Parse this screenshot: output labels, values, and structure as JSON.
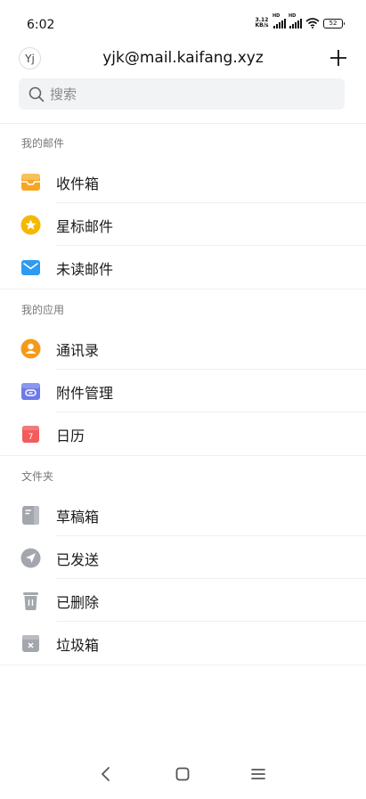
{
  "status_bar": {
    "time": "6:02",
    "net_speed_value": "3.12",
    "net_speed_unit": "KB/s",
    "hd1": "HD",
    "hd2": "HD",
    "battery": "52"
  },
  "header": {
    "avatar_initials": "Yj",
    "account_email": "yjk@mail.kaifang.xyz",
    "add_icon": "plus-icon"
  },
  "search": {
    "placeholder": "搜索",
    "value": ""
  },
  "sections": {
    "my_mail": {
      "title": "我的邮件",
      "items": [
        {
          "label": "收件箱",
          "icon": "inbox-icon",
          "color": "#f7a623"
        },
        {
          "label": "星标邮件",
          "icon": "star-icon",
          "color": "#f5b800"
        },
        {
          "label": "未读邮件",
          "icon": "envelope-icon",
          "color": "#2f9bf0"
        }
      ]
    },
    "my_apps": {
      "title": "我的应用",
      "items": [
        {
          "label": "通讯录",
          "icon": "contacts-icon",
          "color": "#f59a18"
        },
        {
          "label": "附件管理",
          "icon": "attachment-icon",
          "color": "#6e7ae8"
        },
        {
          "label": "日历",
          "icon": "calendar-icon",
          "color": "#f25c5c",
          "badge": "7"
        }
      ]
    },
    "folders": {
      "title": "文件夹",
      "items": [
        {
          "label": "草稿箱",
          "icon": "drafts-icon",
          "color": "#a3a6ad"
        },
        {
          "label": "已发送",
          "icon": "sent-icon",
          "color": "#a3a6ad"
        },
        {
          "label": "已删除",
          "icon": "trash-icon",
          "color": "#a3a6ad"
        },
        {
          "label": "垃圾箱",
          "icon": "spam-icon",
          "color": "#a3a6ad"
        }
      ]
    }
  },
  "nav_bar": {
    "back_icon": "back-icon",
    "home_icon": "home-icon",
    "menu_icon": "menu-icon"
  }
}
